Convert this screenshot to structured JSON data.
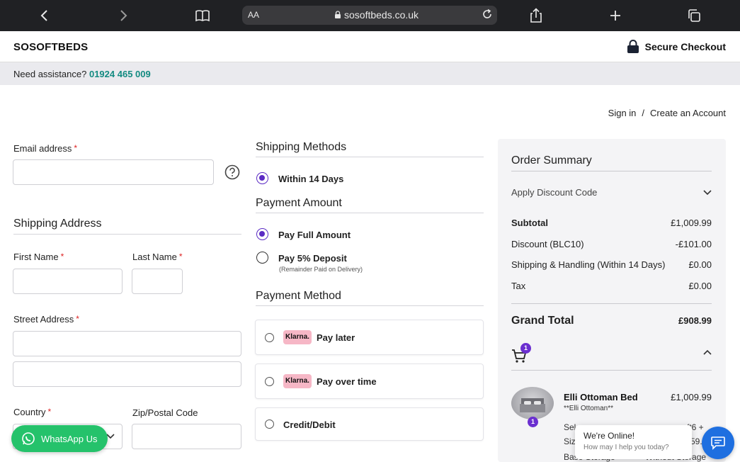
{
  "browser": {
    "aa_label": "AA",
    "url": "sosoftbeds.co.uk"
  },
  "header": {
    "brand": "SOSOFTBEDS",
    "secure_checkout": "Secure Checkout",
    "assist_text": "Need assistance?",
    "assist_phone": "01924 465 009"
  },
  "account": {
    "sign_in": "Sign in",
    "separator": "/",
    "create_account": "Create an Account"
  },
  "form": {
    "email_label": "Email address",
    "required_mark": "*",
    "shipping_address_title": "Shipping Address",
    "first_name_label": "First Name",
    "last_name_label": "Last Name",
    "street_label": "Street Address",
    "country_label": "Country",
    "zip_label": "Zip/Postal Code"
  },
  "shipping": {
    "title": "Shipping Methods",
    "option": "Within 14 Days"
  },
  "payment_amount": {
    "title": "Payment Amount",
    "full": "Pay Full Amount",
    "deposit": "Pay 5% Deposit",
    "deposit_note": "(Remainder Paid on Delivery)"
  },
  "payment_method": {
    "title": "Payment Method",
    "klarna_logo": "Klarna.",
    "pay_later": "Pay later",
    "pay_over_time": "Pay over time",
    "credit_debit": "Credit/Debit"
  },
  "summary": {
    "title": "Order Summary",
    "discount_toggle": "Apply Discount Code",
    "rows": [
      {
        "label": "Subtotal",
        "value": "£1,009.99"
      },
      {
        "label": "Discount (BLC10)",
        "value": "-£101.00"
      },
      {
        "label": "Shipping & Handling (Within 14 Days)",
        "value": "£0.00"
      },
      {
        "label": "Tax",
        "value": "£0.00"
      }
    ],
    "grand_total_label": "Grand Total",
    "grand_total_value": "£908.99",
    "cart_count": "1",
    "product": {
      "name": "Elli Ottoman Bed",
      "price": "£1,009.99",
      "subtitle": "**Elli Ottoman**",
      "qty": "1",
      "line1_left": "Sel",
      "line1_right": "ft6 +",
      "line2_left": "Siz",
      "line2_right": "59.",
      "line3_left": "Base Storage",
      "line3_right": "Without Storage"
    }
  },
  "widgets": {
    "whatsapp": "WhatsApp Us",
    "chat_online": "We're Online!",
    "chat_sub": "How may I help you today?"
  },
  "colors": {
    "accent_purple": "#5b2bc4",
    "phone_teal": "#138b81",
    "whatsapp_green": "#25c26b",
    "chat_blue": "#1e6fe0",
    "klarna_pink": "#f6b7c6"
  }
}
